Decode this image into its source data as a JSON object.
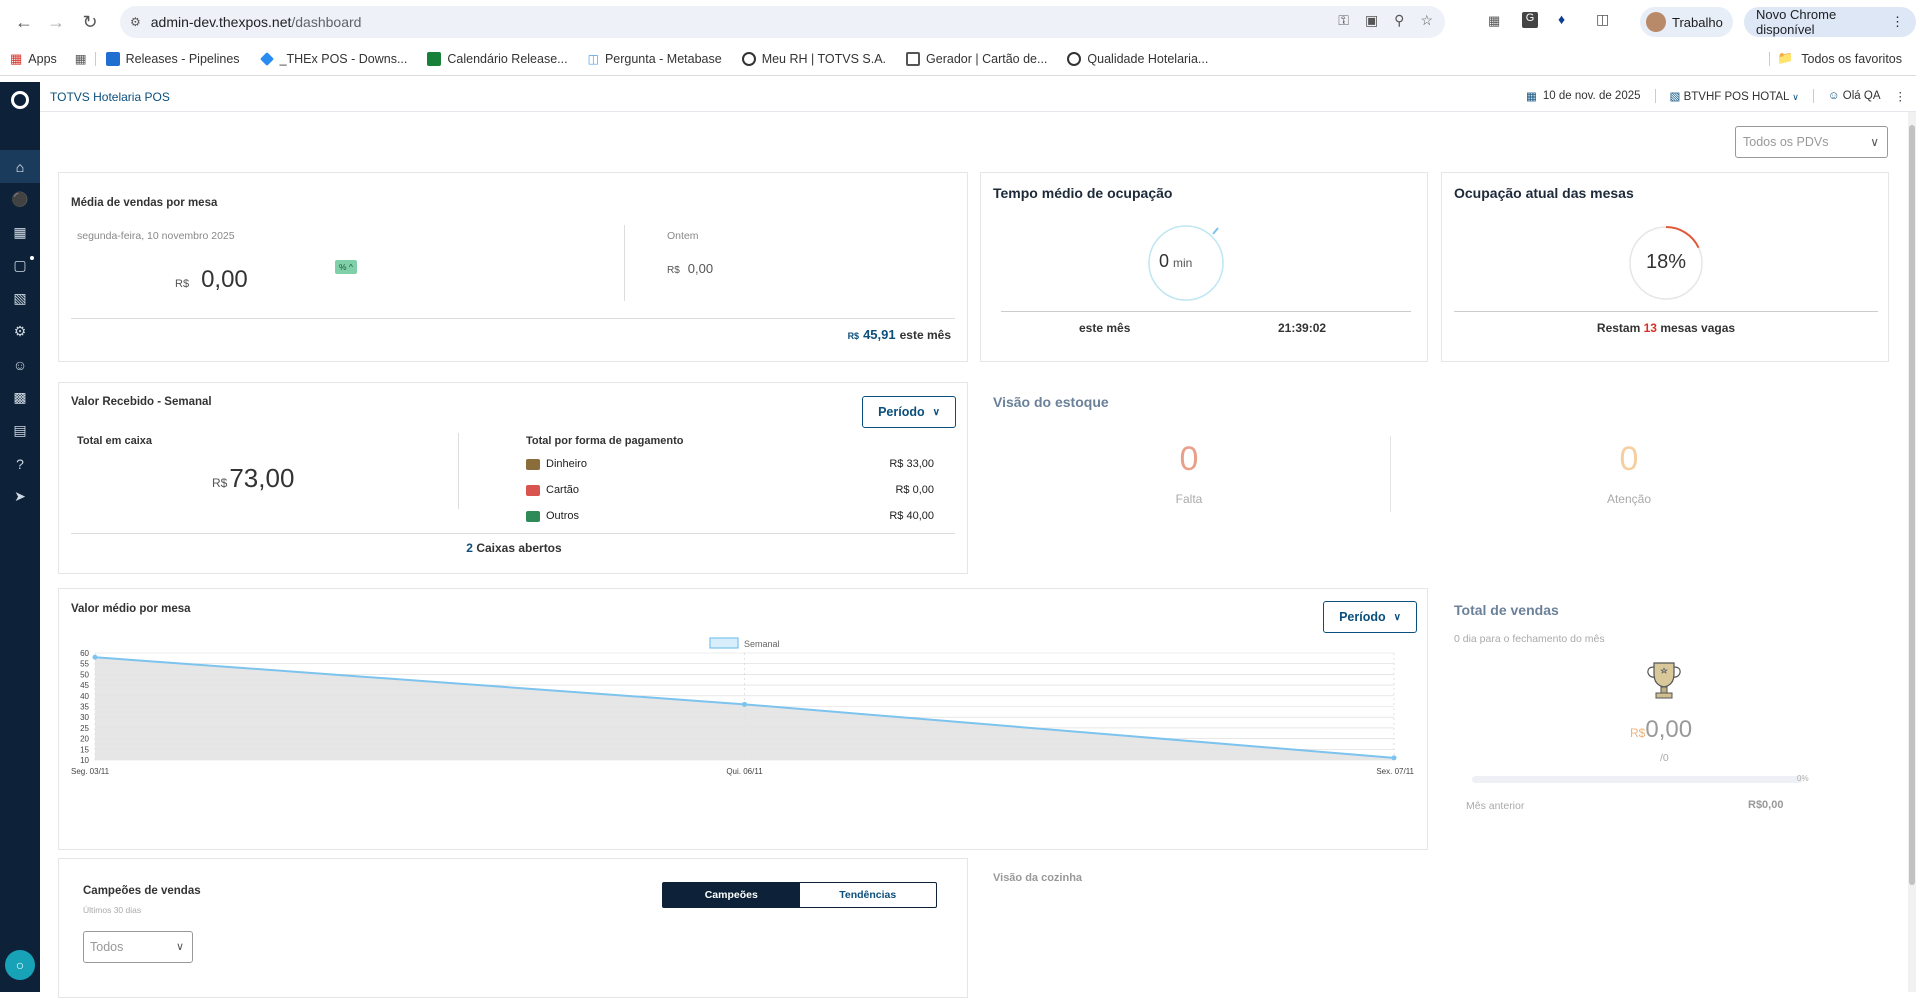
{
  "browser": {
    "url_host": "admin-dev.thexpos.net",
    "url_path": "/dashboard",
    "profile_label": "Trabalho",
    "update_label": "Novo Chrome disponível"
  },
  "bookmarks": {
    "apps": "Apps",
    "items": [
      "Releases - Pipelines",
      "_THEx POS - Downs...",
      "Calendário Release...",
      "Pergunta - Metabase",
      "Meu RH | TOTVS S.A.",
      "Gerador | Cartão de...",
      "Qualidade Hotelaria..."
    ],
    "all_favorites": "Todos os favoritos"
  },
  "header": {
    "app_title": "TOTVS Hotelaria POS",
    "date": "10 de nov. de 2025",
    "property": "BTVHF POS HOTAL",
    "greeting": "Olá QA"
  },
  "filters": {
    "pdv_placeholder": "Todos os PDVs"
  },
  "media_vendas": {
    "title": "Média de vendas por mesa",
    "date_label": "segunda-feira, 10 novembro 2025",
    "currency": "R$",
    "value": "0,00",
    "badge": "% ^",
    "yesterday_label": "Ontem",
    "yesterday_value": "0,00",
    "month_value": "45,91",
    "month_label": "este mês"
  },
  "tempo_ocupacao": {
    "title": "Tempo médio de ocupação",
    "value": "0",
    "unit": "min",
    "period_label": "este mês",
    "time": "21:39:02"
  },
  "ocupacao_mesas": {
    "title": "Ocupação atual das mesas",
    "percent_label": "18%",
    "percent": 18,
    "prefix": "Restam",
    "free_count": "13",
    "suffix": "mesas vagas"
  },
  "valor_recebido": {
    "title": "Valor Recebido - Semanal",
    "period_button": "Período",
    "total_label": "Total em caixa",
    "currency": "R$",
    "total_value": "73,00",
    "payment_title": "Total por forma de pagamento",
    "payments": [
      {
        "label": "Dinheiro",
        "value": "R$ 33,00"
      },
      {
        "label": "Cartão",
        "value": "R$ 0,00"
      },
      {
        "label": "Outros",
        "value": "R$ 40,00"
      }
    ],
    "open_count": "2",
    "open_label": "Caixas abertos"
  },
  "estoque": {
    "title": "Visão do estoque",
    "falta_value": "0",
    "falta_label": "Falta",
    "atencao_value": "0",
    "atencao_label": "Atenção"
  },
  "valor_medio": {
    "title": "Valor médio por mesa",
    "period_button": "Período"
  },
  "chart_data": {
    "type": "area",
    "title": "Valor médio por mesa",
    "categories": [
      "Seg. 03/11",
      "Qui. 06/11",
      "Sex. 07/11"
    ],
    "series": [
      {
        "name": "Semanal",
        "values": [
          58,
          36,
          11
        ]
      }
    ],
    "y_ticks": [
      10,
      15,
      20,
      25,
      30,
      35,
      40,
      45,
      50,
      55,
      60
    ],
    "ylim": [
      10,
      60
    ],
    "legend": "top-center",
    "grid": true,
    "line_color": "#7cc3ee",
    "fill_color": "#e3e3e3"
  },
  "total_vendas": {
    "title": "Total de vendas",
    "subtitle": "0 dia para o fechamento do mês",
    "currency": "R$",
    "value": "0,00",
    "fraction": "/0",
    "progress_label": "0%",
    "progress": 0,
    "prev_label": "Mês anterior",
    "prev_value": "R$0,00"
  },
  "campeoes": {
    "title": "Campeões de vendas",
    "subtitle": "Últimos 30 dias",
    "tab_on": "Campeões",
    "tab_off": "Tendências",
    "filter_value": "Todos"
  },
  "cozinha": {
    "title": "Visão da cozinha"
  }
}
